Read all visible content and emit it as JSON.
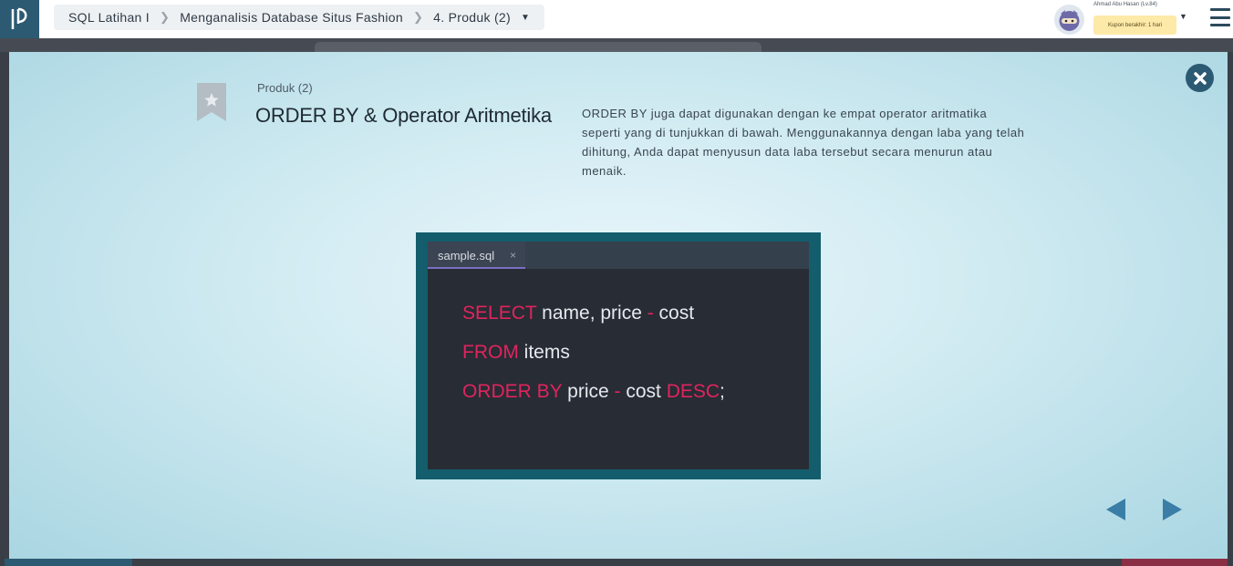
{
  "header": {
    "breadcrumb": [
      "SQL Latihan I",
      "Menganalisis Database Situs Fashion",
      "4. Produk (2)"
    ],
    "user_name": "Ahmad Abu Hasan (Lv.84)",
    "coupon_text": "Kupon berakhir: 1 hari"
  },
  "slide": {
    "subtitle": "Produk (2)",
    "title": "ORDER BY & Operator Aritmetika",
    "description": "ORDER BY juga dapat digunakan dengan ke empat operator aritmatika seperti yang di tunjukkan di bawah. Menggunakannya dengan laba yang telah dihitung, Anda dapat menyusun data laba tersebut secara menurun atau menaik."
  },
  "code": {
    "tab_label": "sample.sql",
    "tab_close": "×",
    "lines": [
      [
        {
          "t": "SELECT",
          "c": "kw"
        },
        {
          "t": " name, price ",
          "c": ""
        },
        {
          "t": "-",
          "c": "op"
        },
        {
          "t": " cost",
          "c": ""
        }
      ],
      [
        {
          "t": "FROM",
          "c": "kw"
        },
        {
          "t": " items",
          "c": ""
        }
      ],
      [
        {
          "t": "ORDER BY",
          "c": "kw"
        },
        {
          "t": " price ",
          "c": ""
        },
        {
          "t": "-",
          "c": "op"
        },
        {
          "t": " cost ",
          "c": ""
        },
        {
          "t": "DESC",
          "c": "kw"
        },
        {
          "t": ";",
          "c": ""
        }
      ]
    ]
  },
  "icons": {
    "logo": "progate-logo-icon",
    "close": "close-icon",
    "bookmark": "bookmark-star-icon",
    "prev": "prev-arrow-icon",
    "next": "next-arrow-icon",
    "menu": "hamburger-menu-icon"
  },
  "colors": {
    "keyword": "#e0245e",
    "code_bg": "#282c34",
    "frame": "#135d6c",
    "brand": "#2c5a73",
    "nav_arrow": "#3a7ea8"
  }
}
